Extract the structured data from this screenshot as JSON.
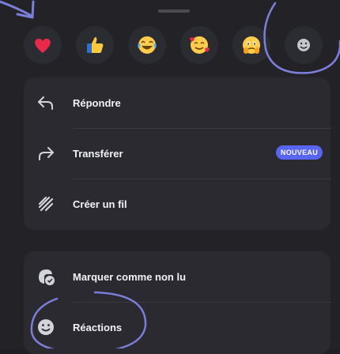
{
  "reactions": [
    {
      "icon": "heart-icon"
    },
    {
      "icon": "thumbs-up-icon"
    },
    {
      "icon": "tears-of-joy-icon"
    },
    {
      "icon": "smiling-face-with-hearts-icon"
    },
    {
      "icon": "face-holding-back-tears-icon"
    },
    {
      "icon": "add-reaction-icon"
    }
  ],
  "menu_primary": [
    {
      "label": "Répondre",
      "icon": "reply-icon"
    },
    {
      "label": "Transférer",
      "icon": "forward-icon",
      "badge": "NOUVEAU"
    },
    {
      "label": "Créer un fil",
      "icon": "thread-icon"
    }
  ],
  "menu_secondary": [
    {
      "label": "Marquer comme non lu",
      "icon": "mark-unread-icon"
    },
    {
      "label": "Réactions",
      "icon": "reactions-icon"
    }
  ],
  "colors": {
    "background": "#222227",
    "card": "#2a2a30",
    "badge": "#5865f2",
    "annotation": "#7b7fd9"
  }
}
